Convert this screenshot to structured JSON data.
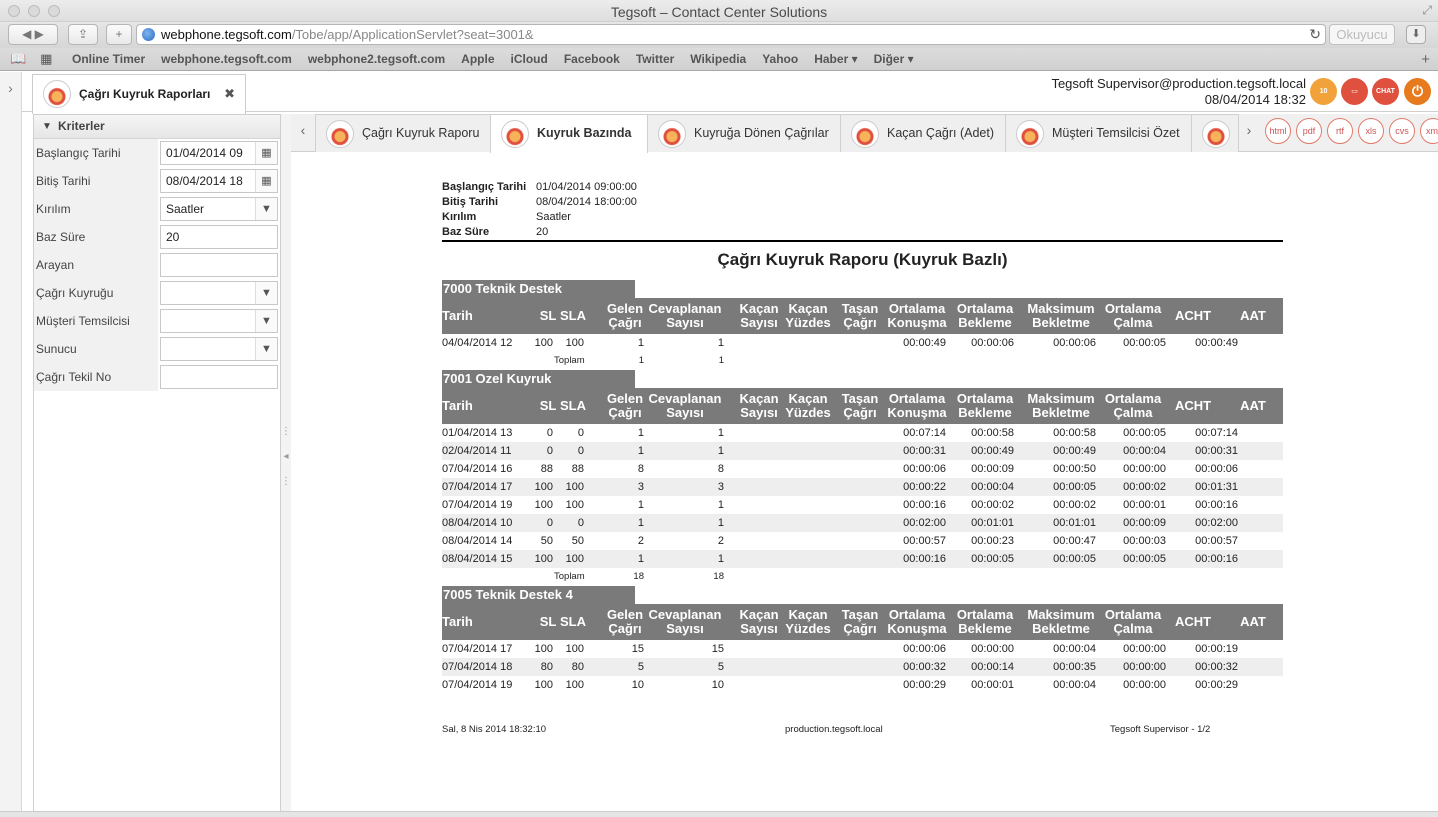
{
  "window": {
    "title": "Tegsoft – Contact Center Solutions"
  },
  "browser": {
    "url_host": "webphone.tegsoft.com",
    "url_path": "/Tobe/app/ApplicationServlet?seat=3001&",
    "reader": "Okuyucu"
  },
  "bookmarks": [
    "Online Timer",
    "webphone.tegsoft.com",
    "webphone2.tegsoft.com",
    "Apple",
    "iCloud",
    "Facebook",
    "Twitter",
    "Wikipedia",
    "Yahoo",
    "Haber ▾",
    "Diğer ▾"
  ],
  "app": {
    "main_tab": "Çağrı Kuyruk Raporları",
    "user": "Tegsoft Supervisor@production.tegsoft.local",
    "datetime": "08/04/2014 18:32",
    "header_icons": [
      "10",
      "",
      "CHAT",
      ""
    ]
  },
  "criteria": {
    "title": "Kriterler",
    "fields": [
      {
        "label": "Başlangıç Tarihi",
        "value": "01/04/2014 09"
      },
      {
        "label": "Bitiş Tarihi",
        "value": "08/04/2014 18"
      },
      {
        "label": "Kırılım",
        "value": "Saatler"
      },
      {
        "label": "Baz Süre",
        "value": "20"
      },
      {
        "label": "Arayan",
        "value": ""
      },
      {
        "label": "Çağrı Kuyruğu",
        "value": ""
      },
      {
        "label": "Müşteri Temsilcisi",
        "value": ""
      },
      {
        "label": "Sunucu",
        "value": ""
      },
      {
        "label": "Çağrı Tekil No",
        "value": ""
      }
    ]
  },
  "report_tabs": [
    "Çağrı Kuyruk Raporu",
    "Kuyruk Bazında",
    "Kuyruğa Dönen Çağrılar",
    "Kaçan Çağrı (Adet)",
    "Müşteri Temsilcisi Özet",
    ""
  ],
  "exports": [
    "html",
    "pdf",
    "rtf",
    "xls",
    "cvs",
    "xml"
  ],
  "report": {
    "params": [
      {
        "k": "Başlangıç Tarihi",
        "v": "01/04/2014 09:00:00"
      },
      {
        "k": "Bitiş Tarihi",
        "v": "08/04/2014 18:00:00"
      },
      {
        "k": "Kırılım",
        "v": "Saatler"
      },
      {
        "k": "Baz Süre",
        "v": "20"
      }
    ],
    "title": "Çağrı Kuyruk Raporu (Kuyruk Bazlı)",
    "headers": [
      "Tarih",
      "SL",
      "SLA",
      "Gelen\nÇağrı",
      "Cevaplanan\nSayısı",
      "Kaçan\nSayısı",
      "Kaçan\nYüzdes",
      "Taşan\nÇağrı",
      "Ortalama\nKonuşma",
      "Ortalama\nBekleme",
      "Maksimum\nBekletme",
      "Ortalama\nÇalma",
      "ACHT",
      "AAT"
    ],
    "total_label": "Toplam",
    "groups": [
      {
        "name": "7000 Teknik Destek",
        "rows": [
          [
            "04/04/2014 12",
            "100",
            "100",
            "1",
            "1",
            "",
            "",
            "",
            "00:00:49",
            "00:00:06",
            "00:00:06",
            "00:00:05",
            "00:00:49",
            ""
          ]
        ],
        "total": [
          "1",
          "1"
        ]
      },
      {
        "name": "7001 Ozel Kuyruk",
        "rows": [
          [
            "01/04/2014 13",
            "0",
            "0",
            "1",
            "1",
            "",
            "",
            "",
            "00:07:14",
            "00:00:58",
            "00:00:58",
            "00:00:05",
            "00:07:14",
            ""
          ],
          [
            "02/04/2014 11",
            "0",
            "0",
            "1",
            "1",
            "",
            "",
            "",
            "00:00:31",
            "00:00:49",
            "00:00:49",
            "00:00:04",
            "00:00:31",
            ""
          ],
          [
            "07/04/2014 16",
            "88",
            "88",
            "8",
            "8",
            "",
            "",
            "",
            "00:00:06",
            "00:00:09",
            "00:00:50",
            "00:00:00",
            "00:00:06",
            ""
          ],
          [
            "07/04/2014 17",
            "100",
            "100",
            "3",
            "3",
            "",
            "",
            "",
            "00:00:22",
            "00:00:04",
            "00:00:05",
            "00:00:02",
            "00:01:31",
            ""
          ],
          [
            "07/04/2014 19",
            "100",
            "100",
            "1",
            "1",
            "",
            "",
            "",
            "00:00:16",
            "00:00:02",
            "00:00:02",
            "00:00:01",
            "00:00:16",
            ""
          ],
          [
            "08/04/2014 10",
            "0",
            "0",
            "1",
            "1",
            "",
            "",
            "",
            "00:02:00",
            "00:01:01",
            "00:01:01",
            "00:00:09",
            "00:02:00",
            ""
          ],
          [
            "08/04/2014 14",
            "50",
            "50",
            "2",
            "2",
            "",
            "",
            "",
            "00:00:57",
            "00:00:23",
            "00:00:47",
            "00:00:03",
            "00:00:57",
            ""
          ],
          [
            "08/04/2014 15",
            "100",
            "100",
            "1",
            "1",
            "",
            "",
            "",
            "00:00:16",
            "00:00:05",
            "00:00:05",
            "00:00:05",
            "00:00:16",
            ""
          ]
        ],
        "total": [
          "18",
          "18"
        ]
      },
      {
        "name": "7005 Teknik Destek 4",
        "rows": [
          [
            "07/04/2014 17",
            "100",
            "100",
            "15",
            "15",
            "",
            "",
            "",
            "00:00:06",
            "00:00:00",
            "00:00:04",
            "00:00:00",
            "00:00:19",
            ""
          ],
          [
            "07/04/2014 18",
            "80",
            "80",
            "5",
            "5",
            "",
            "",
            "",
            "00:00:32",
            "00:00:14",
            "00:00:35",
            "00:00:00",
            "00:00:32",
            ""
          ],
          [
            "07/04/2014 19",
            "100",
            "100",
            "10",
            "10",
            "",
            "",
            "",
            "00:00:29",
            "00:00:01",
            "00:00:04",
            "00:00:00",
            "00:00:29",
            ""
          ]
        ],
        "total": null
      }
    ],
    "footer": {
      "left": "Sal, 8 Nis 2014 18:32:10",
      "center": "production.tegsoft.local",
      "right": "Tegsoft Supervisor - 1/2"
    }
  }
}
